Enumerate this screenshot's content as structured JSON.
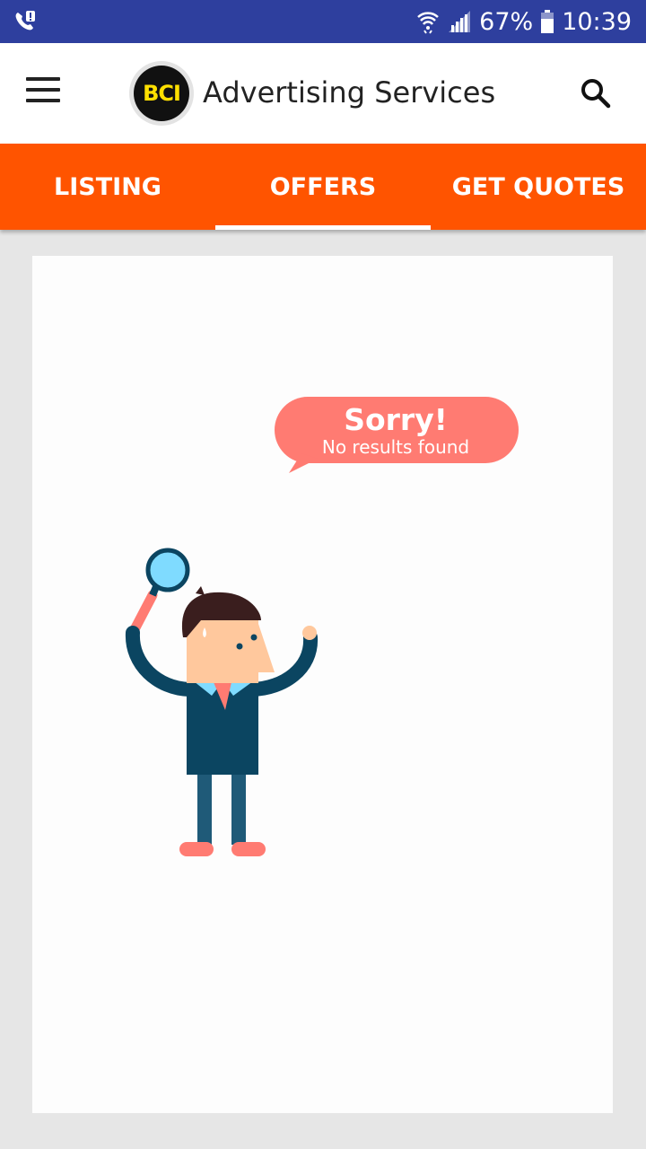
{
  "status_bar": {
    "battery": "67%",
    "time": "10:39"
  },
  "app_bar": {
    "logo_text": "BCI",
    "title": "Advertising Services"
  },
  "tabs": [
    {
      "label": "LISTING",
      "active": false
    },
    {
      "label": "OFFERS",
      "active": true
    },
    {
      "label": "GET QUOTES",
      "active": false
    }
  ],
  "empty_state": {
    "title": "Sorry!",
    "message": "No results found"
  },
  "colors": {
    "status_bar": "#2e3f9e",
    "tab_bar": "#ff5400",
    "bubble": "#ff7b72"
  }
}
